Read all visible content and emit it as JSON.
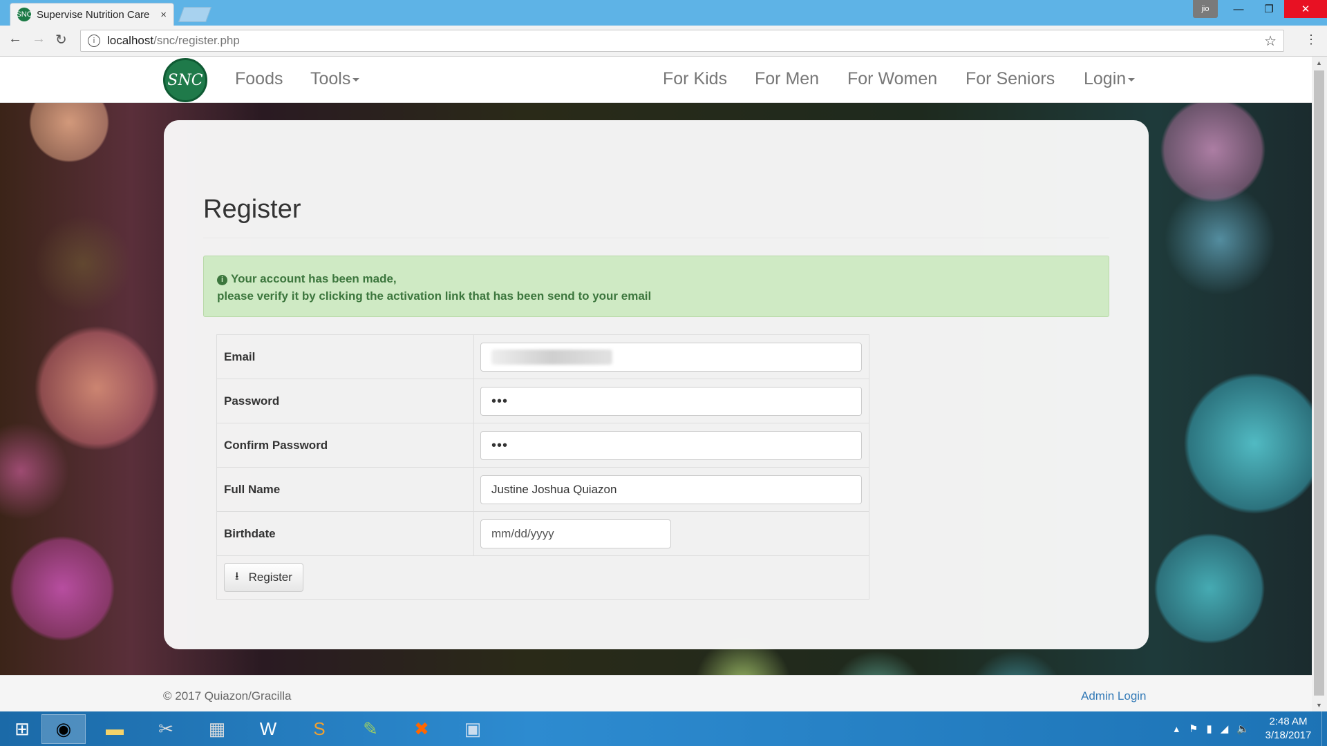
{
  "browser": {
    "tab_title": "Supervise Nutrition Care",
    "tab_close": "×",
    "favicon_text": "SNC",
    "url_host": "localhost",
    "url_path": "/snc/register.php",
    "user_badge": "jio"
  },
  "site": {
    "logo_text": "SNC",
    "nav_left": [
      "Foods",
      "Tools"
    ],
    "nav_right": [
      "For Kids",
      "For Men",
      "For Women",
      "For Seniors",
      "Login"
    ]
  },
  "page": {
    "title": "Register",
    "alert_line1": "Your account has been made,",
    "alert_line2": "please verify it by clicking the activation link that has been send to your email",
    "form": {
      "email_label": "Email",
      "password_label": "Password",
      "password_value": "•••",
      "confirm_label": "Confirm Password",
      "confirm_value": "•••",
      "fullname_label": "Full Name",
      "fullname_value": "Justine Joshua Quiazon",
      "birthdate_label": "Birthdate",
      "birthdate_placeholder": "mm/dd/yyyy",
      "register_button": "Register"
    }
  },
  "footer": {
    "copyright": "©  2017 Quiazon/Gracilla",
    "admin_link": "Admin Login"
  },
  "taskbar": {
    "time": "2:48 AM",
    "date": "3/18/2017"
  }
}
